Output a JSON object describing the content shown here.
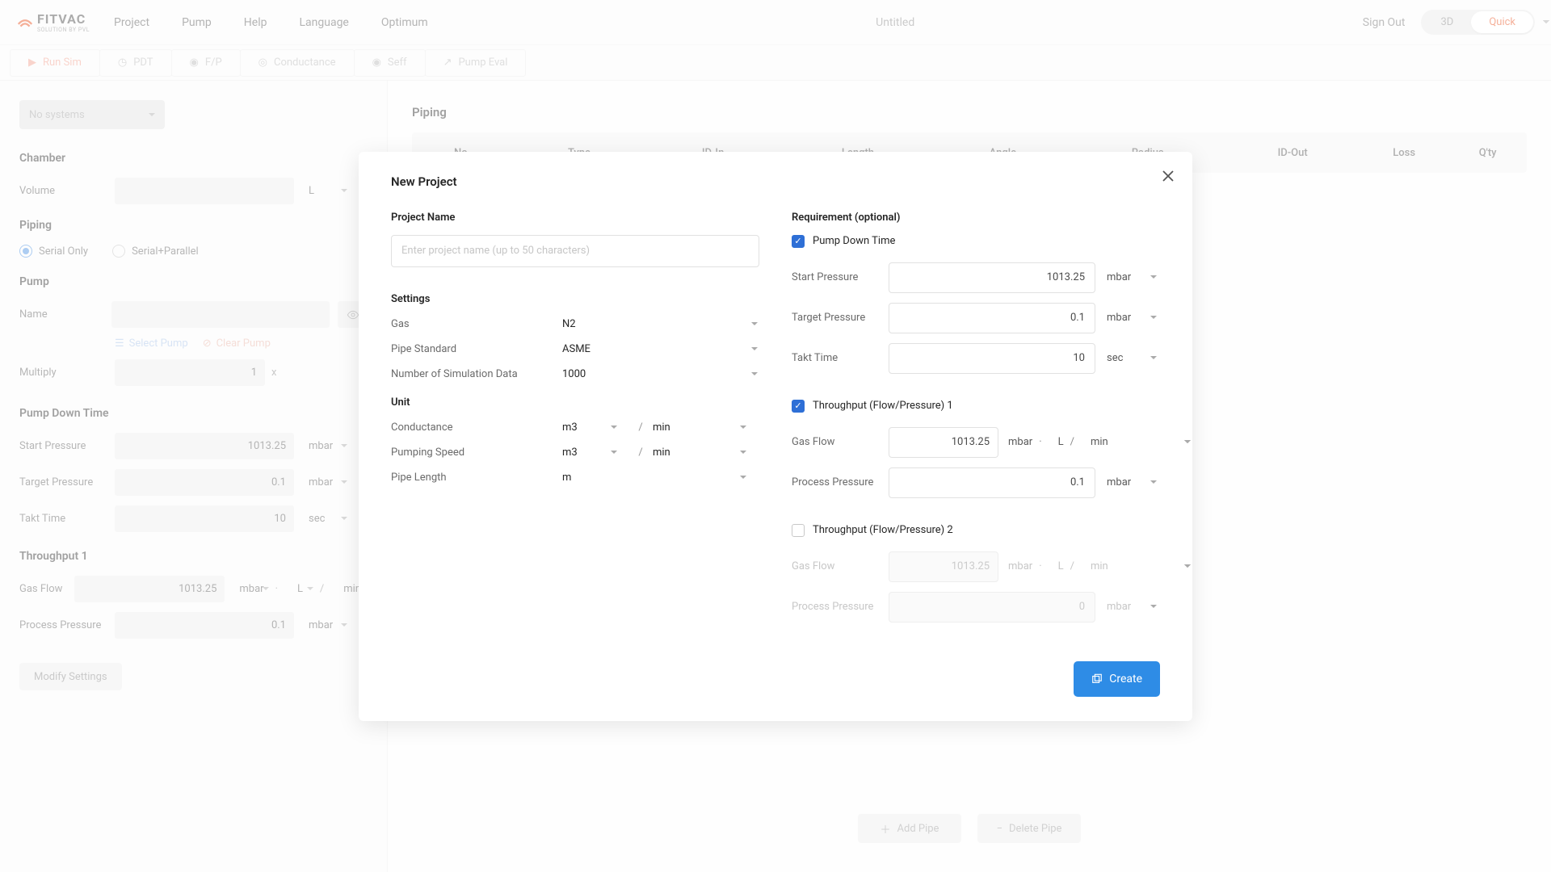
{
  "header": {
    "logo_main": "FITVAC",
    "logo_sub": "SOLUTION BY PVL",
    "menu": [
      "Project",
      "Pump",
      "Help",
      "Language",
      "Optimum"
    ],
    "title": "Untitled",
    "sign_out": "Sign Out",
    "toggle_3d": "3D",
    "toggle_quick": "Quick"
  },
  "toolbar": {
    "run": "Run Sim",
    "pdt": "PDT",
    "fp": "F/P",
    "conductance": "Conductance",
    "seff": "Seff",
    "pumpeval": "Pump Eval"
  },
  "sidebar": {
    "system_select": "No systems",
    "chamber_title": "Chamber",
    "volume_label": "Volume",
    "volume_unit": "L",
    "piping_title": "Piping",
    "radio_serial": "Serial Only",
    "radio_serialpar": "Serial+Parallel",
    "pump_title": "Pump",
    "name_label": "Name",
    "select_pump": "Select Pump",
    "clear_pump": "Clear Pump",
    "multiply_label": "Multiply",
    "multiply_value": "1",
    "multiply_suffix": "x",
    "pdt_title": "Pump Down Time",
    "start_p_label": "Start Pressure",
    "start_p_value": "1013.25",
    "p_unit": "mbar",
    "target_p_label": "Target Pressure",
    "target_p_value": "0.1",
    "takt_label": "Takt Time",
    "takt_value": "10",
    "takt_unit": "sec",
    "thr_title": "Throughput 1",
    "gasflow_label": "Gas Flow",
    "gasflow_value": "1013.25",
    "gasflow_u": "mbar",
    "gasflow_vol": "L",
    "gasflow_min": "min",
    "dot": "·",
    "slash": "/",
    "procpress_label": "Process Pressure",
    "procpress_value": "0.1",
    "modify_btn": "Modify Settings"
  },
  "main": {
    "title": "Piping",
    "cols": [
      "No.",
      "Type",
      "ID-In",
      "Length",
      "Angle",
      "Radius",
      "ID-Out",
      "Loss",
      "Q'ty"
    ],
    "add": "Add Pipe",
    "delete_": "Delete Pipe"
  },
  "modal": {
    "title": "New Project",
    "name_label": "Project Name",
    "name_placeholder": "Enter project name (up to 50 characters)",
    "settings_label": "Settings",
    "gas_label": "Gas",
    "gas_value": "N2",
    "pipe_std_label": "Pipe Standard",
    "pipe_std_value": "ASME",
    "sim_label": "Number of Simulation Data",
    "sim_value": "1000",
    "unit_label": "Unit",
    "cond_label": "Conductance",
    "cond_v": "m3",
    "cond_t": "min",
    "pump_label": "Pumping Speed",
    "pump_v": "m3",
    "pump_t": "min",
    "pipelen_label": "Pipe Length",
    "pipelen_v": "m",
    "slash": "/",
    "req_label": "Requirement (optional)",
    "pdt_check": "Pump Down Time",
    "startp_label": "Start Pressure",
    "startp_value": "1013.25",
    "mbar": "mbar",
    "targetp_label": "Target Pressure",
    "targetp_value": "0.1",
    "takt_label": "Takt Time",
    "takt_value": "10",
    "sec": "sec",
    "thr1_check": "Throughput (Flow/Pressure) 1",
    "gasflow_label": "Gas Flow",
    "gasflow_value": "1013.25",
    "L": "L",
    "min": "min",
    "dot": "·",
    "procp_label": "Process Pressure",
    "procp_value": "0.1",
    "thr2_check": "Throughput (Flow/Pressure) 2",
    "gasflow2_value": "1013.25",
    "procp2_value": "0",
    "create": "Create"
  }
}
